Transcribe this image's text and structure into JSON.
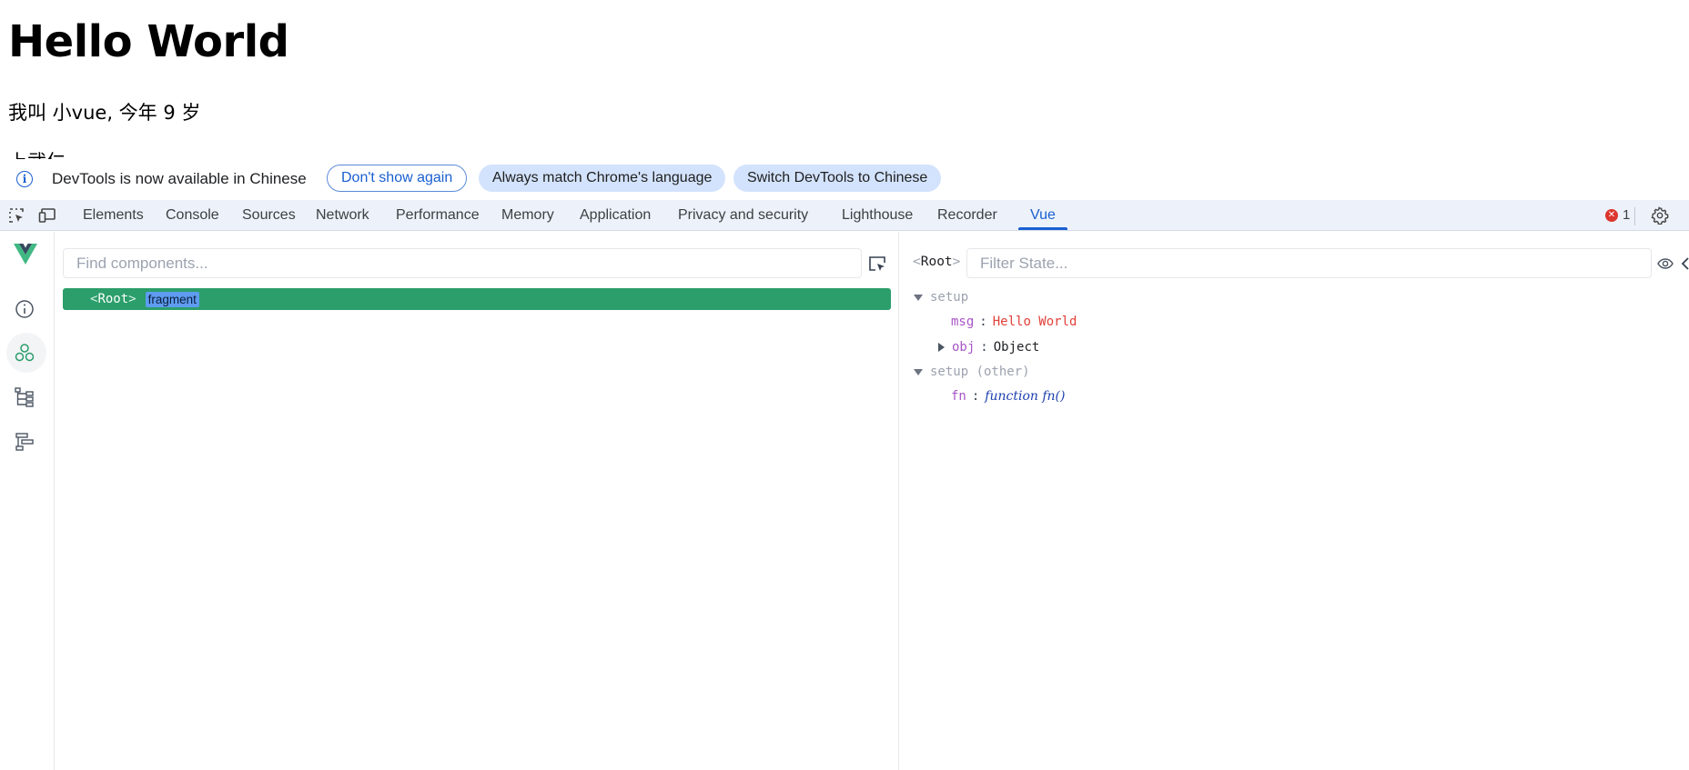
{
  "page": {
    "heading": "Hello World",
    "line1": "我叫 小vue, 今年 9 岁",
    "line2": "上武仁"
  },
  "infobar": {
    "message": "DevTools is now available in Chinese",
    "dont_show": "Don't show again",
    "always_match": "Always match Chrome's language",
    "switch": "Switch DevTools to Chinese"
  },
  "tabs": [
    {
      "label": "Elements"
    },
    {
      "label": "Console"
    },
    {
      "label": "Sources"
    },
    {
      "label": "Network"
    },
    {
      "label": "Performance"
    },
    {
      "label": "Memory"
    },
    {
      "label": "Application"
    },
    {
      "label": "Privacy and security"
    },
    {
      "label": "Lighthouse"
    },
    {
      "label": "Recorder"
    },
    {
      "label": "Vue"
    }
  ],
  "active_tab": "Vue",
  "errors": {
    "count": "1"
  },
  "components": {
    "search_placeholder": "Find components...",
    "root_name": "Root",
    "root_badge": "fragment"
  },
  "state": {
    "root_name": "Root",
    "filter_placeholder": "Filter State...",
    "sections": [
      {
        "title": "setup",
        "entries": [
          {
            "key": "msg",
            "value": "Hello World"
          },
          {
            "key": "obj",
            "value": "Object"
          }
        ]
      },
      {
        "title": "setup (other)",
        "entries": [
          {
            "key": "fn",
            "value": "function fn()"
          }
        ]
      }
    ]
  },
  "colors": {
    "accent": "#1a5fd1",
    "vue_green": "#2b9e6b",
    "tabbar_bg": "#edf2fa",
    "string_value": "#e0413a",
    "key": "#a855c7"
  }
}
